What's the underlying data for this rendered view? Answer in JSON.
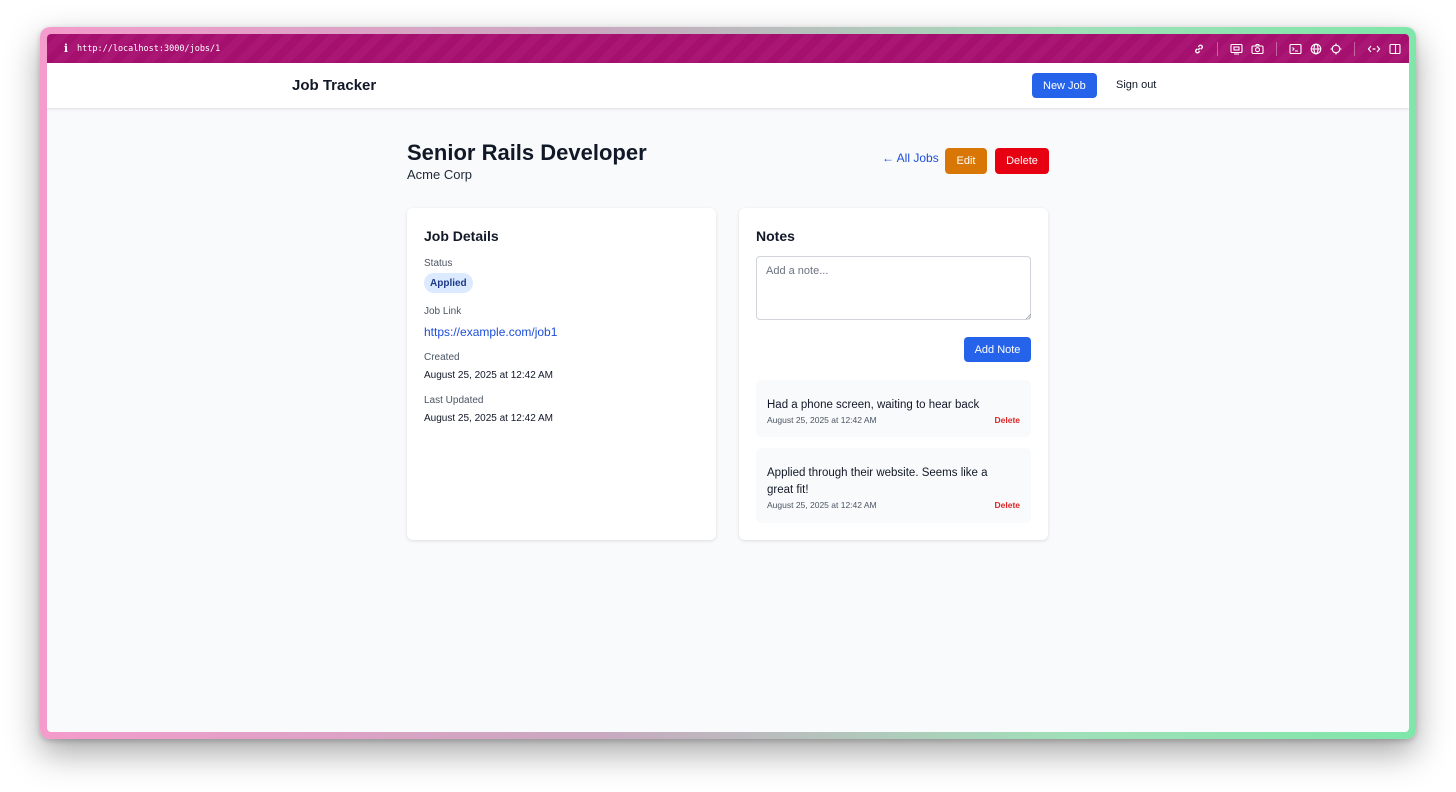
{
  "browser": {
    "url": "http://localhost:3000/jobs/1",
    "info_glyph": "i"
  },
  "nav": {
    "brand": "Job Tracker",
    "new_job_label": "New Job",
    "sign_out_label": "Sign out"
  },
  "job": {
    "title": "Senior Rails Developer",
    "company": "Acme Corp",
    "all_jobs_label": "← All Jobs",
    "edit_label": "Edit",
    "delete_label": "Delete"
  },
  "details": {
    "heading": "Job Details",
    "status_label": "Status",
    "status_value": "Applied",
    "link_label": "Job Link",
    "link_value": "https://example.com/job1",
    "created_label": "Created",
    "created_value": "August 25, 2025 at 12:42 AM",
    "updated_label": "Last Updated",
    "updated_value": "August 25, 2025 at 12:42 AM"
  },
  "notes": {
    "heading": "Notes",
    "input_placeholder": "Add a note...",
    "add_label": "Add Note",
    "items": [
      {
        "text": "Had a phone screen, waiting to hear back",
        "time": "August 25, 2025 at 12:42 AM",
        "delete_label": "Delete"
      },
      {
        "text": "Applied through their website. Seems like a great fit!",
        "time": "August 25, 2025 at 12:42 AM",
        "delete_label": "Delete"
      }
    ]
  },
  "colors": {
    "primary": "#2563eb",
    "edit": "#d97706",
    "danger": "#e60012",
    "browser_bar": "#a5106f"
  },
  "icons": [
    "info-icon",
    "link-icon",
    "screen-icon",
    "camera-icon",
    "terminal-icon",
    "globe-icon",
    "crosshair-icon",
    "code-icon",
    "sidebar-icon",
    "arrow-left-icon"
  ]
}
